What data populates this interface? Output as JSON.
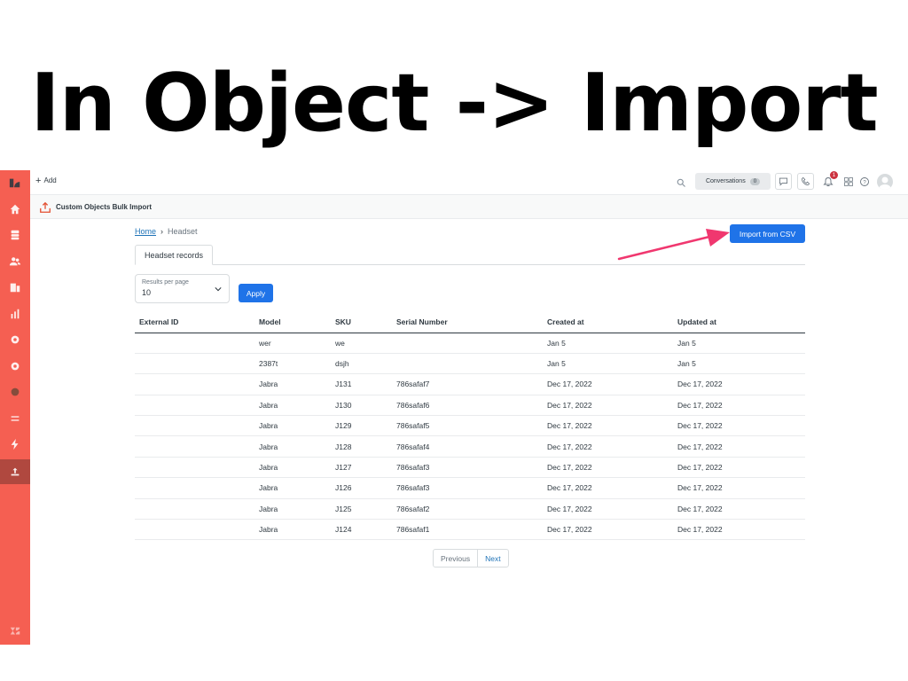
{
  "slide": {
    "title": "In Object -> Import"
  },
  "header": {
    "add_label": "Add",
    "conversations_label": "Conversations",
    "conversations_count": "0",
    "notifications_count": "1"
  },
  "subheader": {
    "title": "Custom Objects Bulk Import"
  },
  "breadcrumb": {
    "home": "Home",
    "separator": "›",
    "current": "Headset"
  },
  "import_button": "Import from CSV",
  "tab": {
    "label": "Headset records"
  },
  "results_per_page": {
    "label": "Results per page",
    "value": "10"
  },
  "apply_button": "Apply",
  "table": {
    "columns": [
      "External ID",
      "Model",
      "SKU",
      "Serial Number",
      "Created at",
      "Updated at"
    ],
    "rows": [
      [
        "",
        "wer",
        "we",
        "",
        "Jan 5",
        "Jan 5"
      ],
      [
        "",
        "2387t",
        "dsjh",
        "",
        "Jan 5",
        "Jan 5"
      ],
      [
        "",
        "Jabra",
        "J131",
        "786safaf7",
        "Dec 17, 2022",
        "Dec 17, 2022"
      ],
      [
        "",
        "Jabra",
        "J130",
        "786safaf6",
        "Dec 17, 2022",
        "Dec 17, 2022"
      ],
      [
        "",
        "Jabra",
        "J129",
        "786safaf5",
        "Dec 17, 2022",
        "Dec 17, 2022"
      ],
      [
        "",
        "Jabra",
        "J128",
        "786safaf4",
        "Dec 17, 2022",
        "Dec 17, 2022"
      ],
      [
        "",
        "Jabra",
        "J127",
        "786safaf3",
        "Dec 17, 2022",
        "Dec 17, 2022"
      ],
      [
        "",
        "Jabra",
        "J126",
        "786safaf3",
        "Dec 17, 2022",
        "Dec 17, 2022"
      ],
      [
        "",
        "Jabra",
        "J125",
        "786safaf2",
        "Dec 17, 2022",
        "Dec 17, 2022"
      ],
      [
        "",
        "Jabra",
        "J124",
        "786safaf1",
        "Dec 17, 2022",
        "Dec 17, 2022"
      ]
    ]
  },
  "pagination": {
    "previous": "Previous",
    "next": "Next"
  },
  "nav_items": [
    "zendesk-logo-icon",
    "home-icon",
    "views-icon",
    "customers-icon",
    "organizations-icon",
    "reporting-icon",
    "admin-icon",
    "settings-icon",
    "app-icon",
    "switch-icon",
    "bolt-icon",
    "upload-icon",
    "zendesk-z-icon"
  ],
  "colors": {
    "nav": "#f55f52",
    "nav_active": "#b0483f",
    "primary_button": "#1f73e8",
    "annotation_arrow": "#f0376f"
  }
}
